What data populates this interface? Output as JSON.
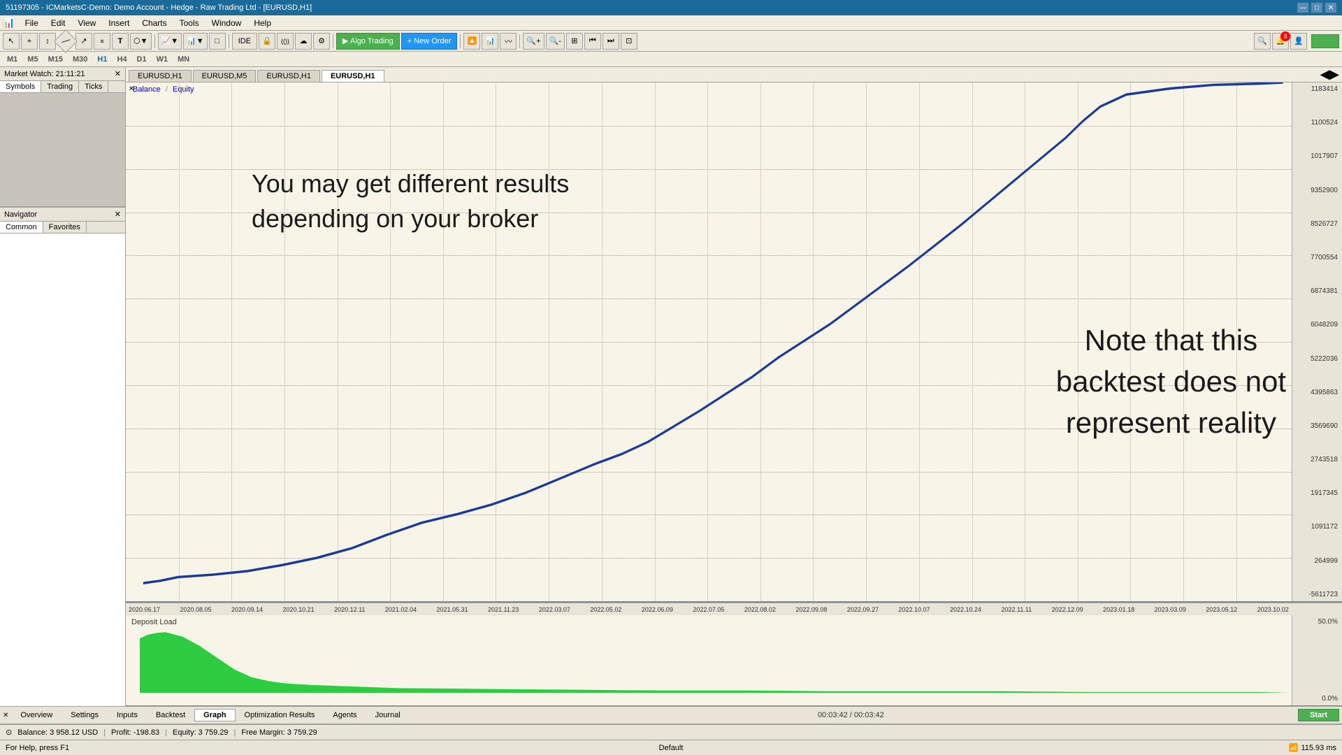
{
  "titleBar": {
    "title": "51197305 - ICMarketsC-Demo: Demo Account - Hedge - Raw Trading Ltd - [EURUSD,H1]",
    "minimize": "—",
    "maximize": "□",
    "close": "✕"
  },
  "menuBar": {
    "items": [
      "File",
      "Edit",
      "View",
      "Insert",
      "Charts",
      "Tools",
      "Window",
      "Help"
    ]
  },
  "toolbar": {
    "items": [
      "↖",
      "+",
      "↕",
      "/",
      "↗",
      "≡≡",
      "T",
      "⬡▼",
      "□▼",
      "□▼",
      "□",
      "IDE",
      "🔒",
      "(())",
      "☁",
      "⚙"
    ],
    "algoTrading": "▶ Algo Trading",
    "newOrder": "+ New Order",
    "searchIcon": "🔍",
    "profileIcon": "👤",
    "signalIcon": "📶",
    "statusGreen": "#4CAF50"
  },
  "timeframes": {
    "items": [
      "M1",
      "M5",
      "M15",
      "M30",
      "H1",
      "H4",
      "D1",
      "W1",
      "MN"
    ],
    "active": "H1"
  },
  "panels": {
    "marketWatch": {
      "title": "Market Watch: 21:11:21",
      "tabs": [
        "Symbols",
        "Trading",
        "Ticks"
      ]
    },
    "navigator": {
      "title": "Navigator",
      "tabs": [
        "Common",
        "Favorites"
      ]
    }
  },
  "chartTabs": [
    "EURUSD,H1",
    "EURUSD,M5",
    "EURUSD,H1",
    "EURUSD,H1"
  ],
  "activeChartTab": 3,
  "chartLabel": {
    "text": "Balance / Equity"
  },
  "annotations": {
    "text1": "You may get different results\ndepending on your broker",
    "text2": "Note that this\nbacktest does not\nrepresent reality"
  },
  "yAxis": {
    "labels": [
      "1183414",
      "1100524",
      "1017907",
      "9352900",
      "8526727",
      "7700554",
      "6874381",
      "6048209",
      "5222036",
      "4395863",
      "3569690",
      "2743518",
      "1917345",
      "1091172",
      "264999",
      "-5611723"
    ]
  },
  "depositLoad": {
    "label": "Deposit Load",
    "yLabels": [
      "50.0%",
      "0.0%"
    ]
  },
  "xAxis": {
    "labels": [
      "2020.06.17",
      "2020.08.05",
      "2020.09.14",
      "2020.10.21",
      "2020.12.11",
      "2021.02.04",
      "2021.05.31",
      "2021.11.23",
      "2022.03.07",
      "2022.05.02",
      "2022.06.09",
      "2022.07.05",
      "2022.08.02",
      "2022.09.08",
      "2022.09.27",
      "2022.10.07",
      "2022.10.24",
      "2022.11.11",
      "2022.12.09",
      "2023.01.18",
      "2023.03.09",
      "2023.05.12",
      "2023.10.02"
    ]
  },
  "bottomTabs": {
    "items": [
      "Overview",
      "Settings",
      "Inputs",
      "Backtest",
      "Graph",
      "Optimization Results",
      "Agents",
      "Journal"
    ],
    "active": "Graph",
    "timeDisplay": "00:03:42 / 00:03:42",
    "startBtn": "Start"
  },
  "statusBar": {
    "balance": "Balance: 3 958.12 USD",
    "profit": "Profit: -198.83",
    "equity": "Equity: 3 759.29",
    "freeMargin": "Free Margin: 3 759.29"
  },
  "bottomInfo": {
    "help": "For Help, press F1",
    "profile": "Default",
    "signal": "115.93 ms"
  }
}
